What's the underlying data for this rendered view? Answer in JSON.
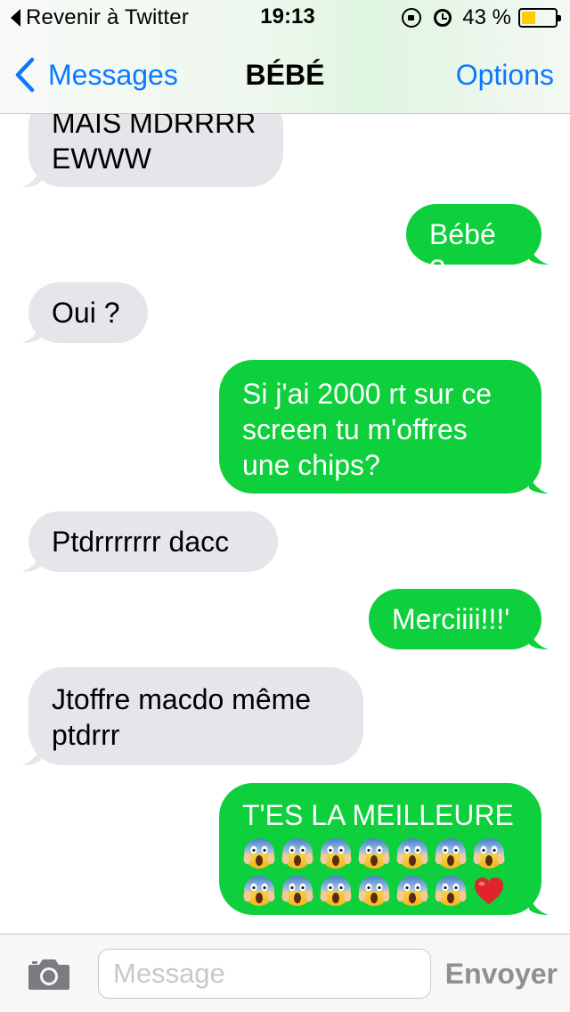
{
  "status_bar": {
    "back_app_label": "Revenir à Twitter",
    "time": "19:13",
    "battery_percent": "43 %",
    "battery_level": 0.43,
    "battery_color": "#ffcc00"
  },
  "nav": {
    "back_label": "Messages",
    "title": "BÉBÉ",
    "options_label": "Options",
    "accent_color": "#0a7afe"
  },
  "messages": [
    {
      "direction": "received",
      "text": "MAIS MDRRRR\nEWWW"
    },
    {
      "direction": "sent",
      "text": "Bébé ?"
    },
    {
      "direction": "received",
      "text": "Oui ?"
    },
    {
      "direction": "sent",
      "text": "Si j'ai 2000 rt sur ce\nscreen tu m'offres\nune chips?"
    },
    {
      "direction": "received",
      "text": "Ptdrrrrrrr dacc"
    },
    {
      "direction": "sent",
      "text": "Merciiii!!!'"
    },
    {
      "direction": "received",
      "text": "Jtoffre macdo même\nptdrrr"
    },
    {
      "direction": "sent",
      "text": "T'ES LA MEILLEURE",
      "emoji_rows": [
        [
          "face-screaming-in-fear",
          "face-screaming-in-fear",
          "face-screaming-in-fear",
          "face-screaming-in-fear",
          "face-screaming-in-fear",
          "face-screaming-in-fear",
          "face-screaming-in-fear"
        ],
        [
          "face-screaming-in-fear",
          "face-screaming-in-fear",
          "face-screaming-in-fear",
          "face-screaming-in-fear",
          "face-screaming-in-fear",
          "face-screaming-in-fear",
          "red-heart"
        ]
      ]
    }
  ],
  "colors": {
    "sent_bubble": "#0ecf3c",
    "received_bubble": "#e5e5ea"
  },
  "input_bar": {
    "camera_icon": "camera-icon",
    "placeholder": "Message",
    "send_label": "Envoyer"
  }
}
